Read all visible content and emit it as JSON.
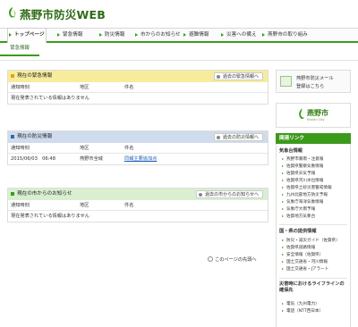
{
  "header": {
    "title": "燕野市防災WEB"
  },
  "nav": {
    "items": [
      "トップページ",
      "緊急情報",
      "防災情報",
      "市からのお知らせ",
      "避難情報",
      "災害への備え",
      "燕野市の取り組み"
    ],
    "active_sub": "緊急情報"
  },
  "panels": [
    {
      "title": "現在の緊急情報",
      "more": "過去の緊急情報へ",
      "head_color": "#f7ec9c",
      "icon_color": "#e3a21a",
      "columns": [
        "通知時刻",
        "地区",
        "件名"
      ],
      "rows": [
        [
          "現在発表されている情報はありません",
          "",
          ""
        ]
      ]
    },
    {
      "title": "現在の防災情報",
      "more": "過去の防災情報へ",
      "head_color": "#cfdced",
      "icon_color": "#3b66a8",
      "columns": [
        "通知時刻",
        "地区",
        "件名"
      ],
      "rows": [
        [
          "2015/06/03　06:48",
          "燕野市全域",
          "同報主要追加点"
        ]
      ]
    },
    {
      "title": "現在の市からのお知らせ",
      "more": "過去の市からのお知らせへ",
      "head_color": "#d9efd0",
      "icon_color": "#3c9a1b",
      "columns": [
        "通知時刻",
        "地区",
        "件名"
      ],
      "rows": [
        [
          "現在発表されている情報はありません",
          "",
          ""
        ]
      ]
    }
  ],
  "page_top": "このページの先頭へ",
  "side": {
    "mail": {
      "line1": "燕野市防災メール",
      "line2": "登録はこちら"
    },
    "city": {
      "name": "燕野市",
      "sub": "Enoshi City"
    },
    "links_title": "関連リンク",
    "groups": [
      {
        "title": "気象台情報",
        "items": [
          "燕野市暴雨・注意報",
          "佐賀県警察気象情報",
          "佐賀県天気予報",
          "佐賀県河川水位情報",
          "佐賀県土砂災害警戒情報",
          "九州北部地方防災予報",
          "気象庁海洋気象情報",
          "気象庁大雨予報",
          "佐賀地方気象台"
        ]
      },
      {
        "title": "国・県の提供情報",
        "items": [
          "防災・減災ガイド（佐賀県）",
          "佐賀県道路情報",
          "安全情報（佐賀県）",
          "国土交通省・河川情報",
          "国土交通省・Jアラート"
        ]
      },
      {
        "title": "災害時におけるライフラインの確保先",
        "items": [
          "電気（九州電力）",
          "電話（NTT西日本）"
        ]
      }
    ]
  }
}
